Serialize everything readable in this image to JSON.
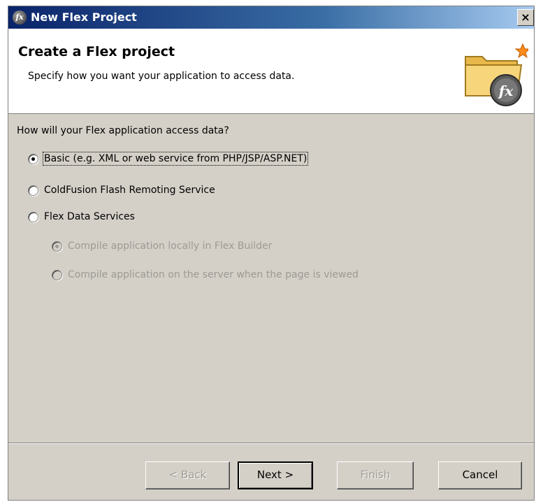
{
  "window": {
    "title": "New Flex Project",
    "close_label": "×"
  },
  "header": {
    "title": "Create a Flex project",
    "description": "Specify how you want your application to access data."
  },
  "main": {
    "question": "How will your Flex application access data?",
    "options": [
      {
        "label": "Basic (e.g. XML or web service from PHP/JSP/ASP.NET)",
        "checked": true,
        "enabled": true
      },
      {
        "label": "ColdFusion Flash Remoting Service",
        "checked": false,
        "enabled": true
      },
      {
        "label": "Flex Data Services",
        "checked": false,
        "enabled": true
      }
    ],
    "sub_options": [
      {
        "label": "Compile application locally in Flex Builder",
        "checked": true,
        "enabled": false
      },
      {
        "label": "Compile application on the server when the page is viewed",
        "checked": false,
        "enabled": false
      }
    ]
  },
  "buttons": {
    "back": "< Back",
    "next": "Next >",
    "finish": "Finish",
    "cancel": "Cancel"
  },
  "colors": {
    "titlebar_start": "#0a246a",
    "titlebar_end": "#a6caf0",
    "dialog_bg": "#d4d0c8",
    "disabled_text": "#9c9a94"
  },
  "icons": {
    "title": "flex-logo-icon",
    "banner": "flex-project-folder-icon"
  }
}
